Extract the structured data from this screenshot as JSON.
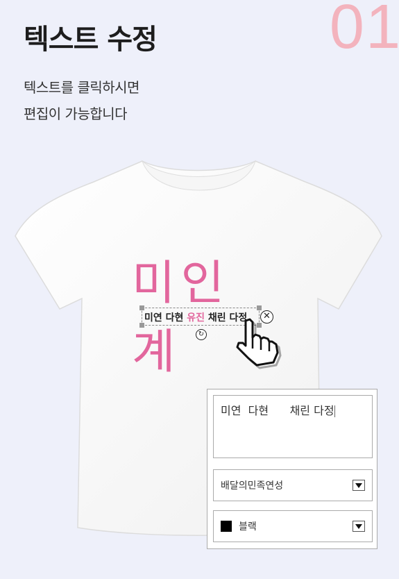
{
  "header": {
    "step_number": "01",
    "title": "텍스트 수정",
    "description_line1": "텍스트를 클릭하시면",
    "description_line2": "편집이 가능합니다"
  },
  "tshirt_print": {
    "title": "미인계",
    "text_before": "미연 다현 ",
    "text_highlight": "유진",
    "text_after": " 채린 다정"
  },
  "edit_panel": {
    "text_value": "미연  다현      채린 다정",
    "font_value": "배달의민족연성",
    "color_value": "블랙",
    "colors": {
      "accent": "#e2669d",
      "step_number": "#f3b3bd",
      "swatch": "#000000"
    }
  },
  "icons": [
    "delete-icon",
    "rotate-icon",
    "hand-cursor-icon",
    "dropdown-arrow-icon"
  ]
}
